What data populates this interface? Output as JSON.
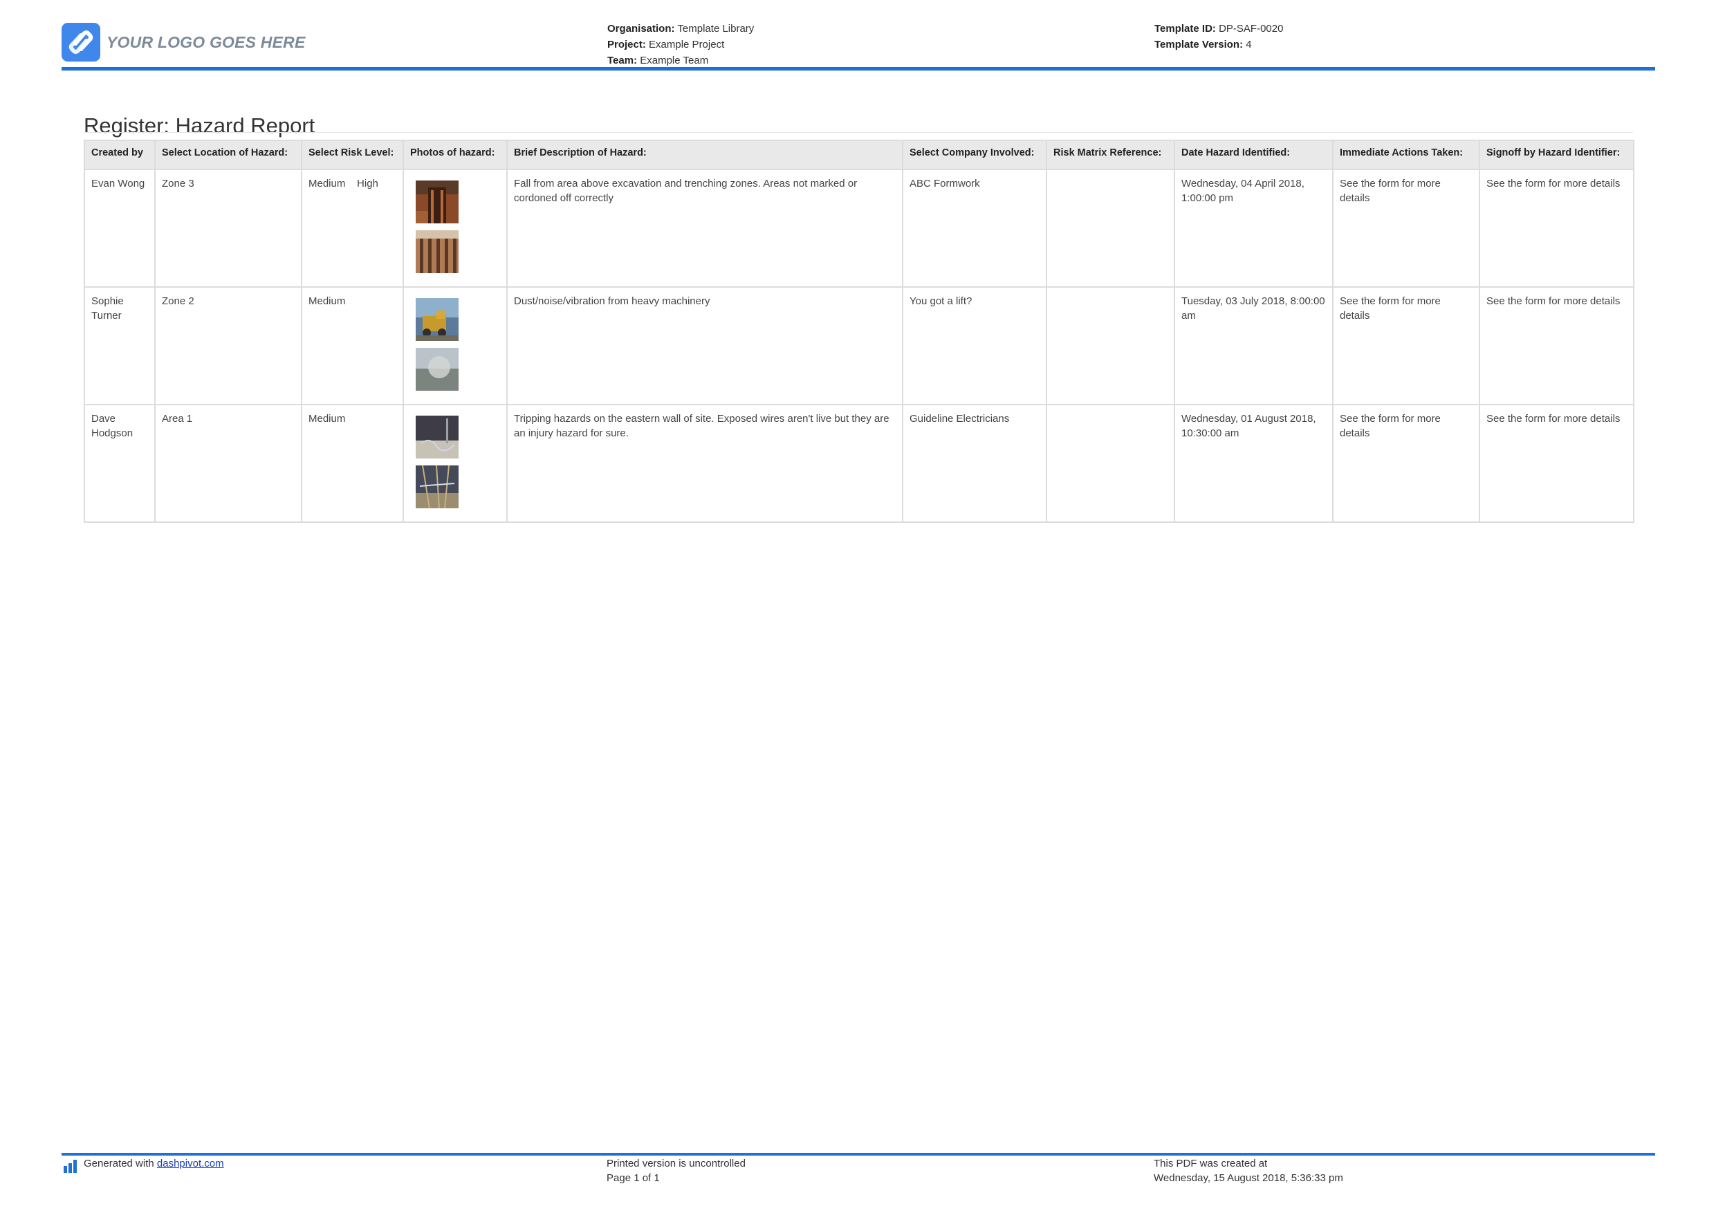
{
  "header": {
    "logo_text": "YOUR LOGO GOES HERE",
    "organisation_label": "Organisation:",
    "organisation_value": "Template Library",
    "project_label": "Project:",
    "project_value": "Example Project",
    "team_label": "Team:",
    "team_value": "Example Team",
    "template_id_label": "Template ID:",
    "template_id_value": "DP-SAF-0020",
    "template_version_label": "Template Version:",
    "template_version_value": "4"
  },
  "title": "Register: Hazard Report",
  "table": {
    "columns": [
      "Created by",
      "Select Location of Hazard:",
      "Select Risk Level:",
      "Photos of hazard:",
      "Brief Description of Hazard:",
      "Select Company Involved:",
      "Risk Matrix Reference:",
      "Date Hazard Identified:",
      "Immediate Actions Taken:",
      "Signoff by Hazard Identifier:"
    ],
    "rows": [
      {
        "created_by": "Evan Wong",
        "location": "Zone 3",
        "risk_level": "Medium",
        "risk_level_extra": "High",
        "description": "Fall from area above excavation and trenching zones. Areas not marked or cordoned off correctly",
        "company": "ABC Formwork",
        "risk_matrix": "",
        "date": "Wednesday, 04 April 2018, 1:00:00 pm",
        "actions": "See the form for more details",
        "signoff": "See the form for more details"
      },
      {
        "created_by": "Sophie Turner",
        "location": "Zone 2",
        "risk_level": "Medium",
        "risk_level_extra": "",
        "description": "Dust/noise/vibration from heavy machinery",
        "company": "You got a lift?",
        "risk_matrix": "",
        "date": "Tuesday, 03 July 2018, 8:00:00 am",
        "actions": "See the form for more details",
        "signoff": "See the form for more details"
      },
      {
        "created_by": "Dave Hodgson",
        "location": "Area 1",
        "risk_level": "Medium",
        "risk_level_extra": "",
        "description": "Tripping hazards on the eastern wall of site. Exposed wires aren't live but they are an injury hazard for sure.",
        "company": "Guideline Electricians",
        "risk_matrix": "",
        "date": "Wednesday, 01 August 2018, 10:30:00 am",
        "actions": "See the form for more details",
        "signoff": "See the form for more details"
      }
    ]
  },
  "footer": {
    "generated_prefix": "Generated with ",
    "generated_link": "dashpivot.com",
    "printed_notice": "Printed version is uncontrolled",
    "page_label": "Page 1 of 1",
    "created_label": "This PDF was created at",
    "created_value": "Wednesday, 15 August 2018, 5:36:33 pm"
  },
  "colors": {
    "accent": "#1f6fd8",
    "logo": "#3f87ea",
    "header_fill": "#e9e9e9"
  }
}
